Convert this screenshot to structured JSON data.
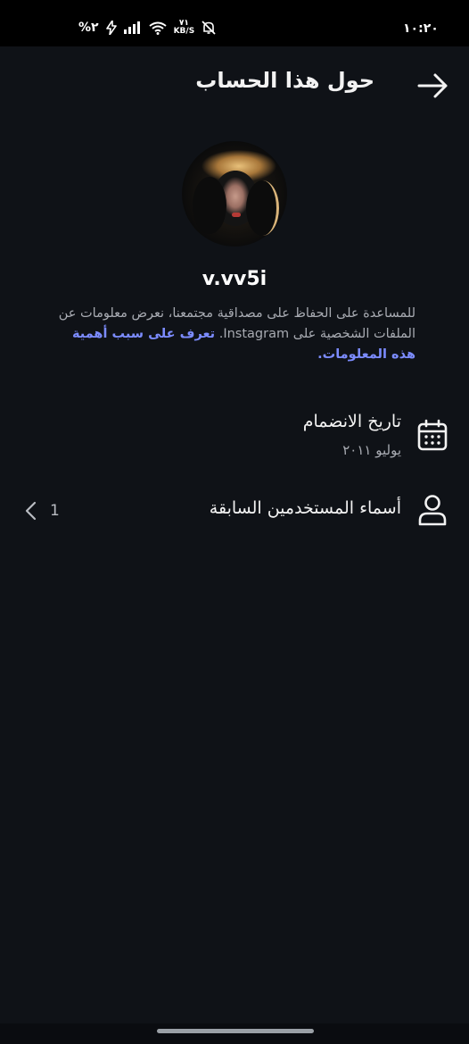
{
  "status_bar": {
    "time": "١٠:٢٠",
    "battery": "%٢",
    "net_speed_value": "٧١",
    "net_speed_unit": "KB/S"
  },
  "header": {
    "title": "حول هذا الحساب"
  },
  "profile": {
    "username": "v.vv5i",
    "description": "للمساعدة على الحفاظ على مصداقية مجتمعنا، نعرض معلومات عن الملفات الشخصية على Instagram.",
    "learn_more": "تعرف على سبب أهمية هذه المعلومات."
  },
  "date_joined": {
    "title": "تاريخ الانضمام",
    "value": "يوليو ٢٠١١"
  },
  "former_usernames": {
    "title": "أسماء المستخدمين السابقة",
    "count": "1"
  },
  "colors": {
    "background": "#0f1217",
    "link": "#7c8cff"
  }
}
